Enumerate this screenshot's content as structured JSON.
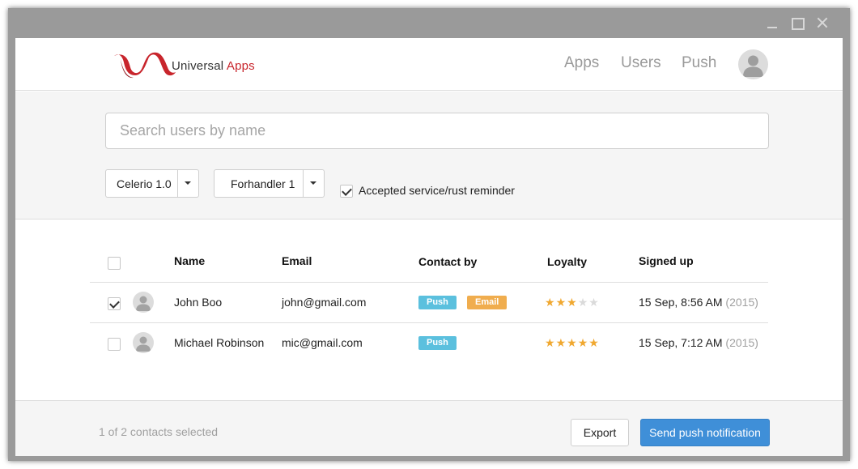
{
  "app": {
    "brand_word1": "Universal",
    "brand_word2": "Apps",
    "brand_color": "#c8252c"
  },
  "nav": {
    "items": [
      {
        "label": "Apps"
      },
      {
        "label": "Users"
      },
      {
        "label": "Push"
      }
    ],
    "avatar_icon": "user-avatar-icon"
  },
  "filters": {
    "search_placeholder": "Search users by name",
    "search_value": "",
    "select_model": "Celerio 1.0",
    "select_dealer": "Forhandler 1",
    "accepted_label": "Accepted service/rust reminder",
    "accepted_checked": true
  },
  "table": {
    "headers": {
      "name": "Name",
      "email": "Email",
      "contact": "Contact by",
      "loyalty": "Loyalty",
      "signed": "Signed up"
    },
    "rows": [
      {
        "checked": true,
        "name": "John Boo",
        "email": "john@gmail.com",
        "contact": [
          "Push",
          "Email"
        ],
        "loyalty": 3,
        "signed_date": "15 Sep, 8:56 AM",
        "signed_year": "(2015)"
      },
      {
        "checked": false,
        "name": "Michael Robinson",
        "email": "mic@gmail.com",
        "contact": [
          "Push"
        ],
        "loyalty": 5,
        "signed_date": "15 Sep, 7:12 AM",
        "signed_year": "(2015)"
      }
    ]
  },
  "footer": {
    "selected_text": "1 of 2 contacts selected",
    "export_label": "Export",
    "send_label": "Send push notification"
  },
  "colors": {
    "push_badge": "#5bc0de",
    "email_badge": "#f0ad4e",
    "primary_button": "#3f8fd8",
    "star": "#f0a830"
  }
}
